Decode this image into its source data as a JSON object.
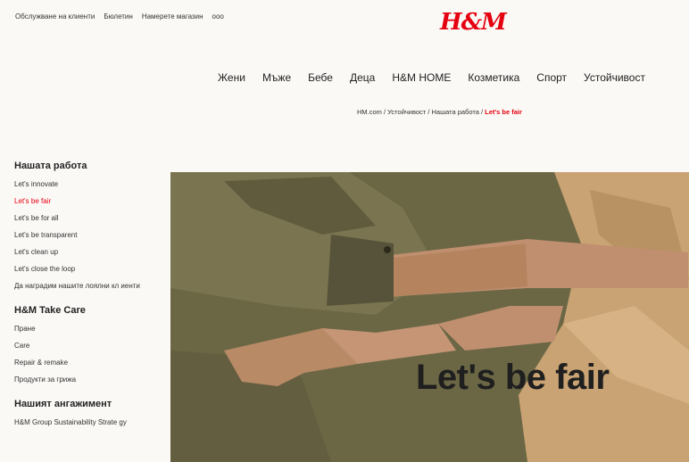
{
  "topbar": {
    "links": [
      "Обслужване на клиенти",
      "Бюлетин",
      "Намерете магазин",
      "ооо"
    ]
  },
  "logo": "H&M",
  "nav": {
    "items": [
      "Жени",
      "Мъже",
      "Бебе",
      "Деца",
      "H&M HOME",
      "Козметика",
      "Спорт",
      "Устойчивост"
    ]
  },
  "breadcrumb": {
    "path": "HM.com / Устойчивост / Нашата работа / ",
    "current": "Let's be fair"
  },
  "sidebar": {
    "sections": [
      {
        "title": "Нашата работа",
        "items": [
          "Let's innovate",
          "Let's be fair",
          "Let's be for all",
          "Let's be transparent",
          "Let's clean up",
          "Let's close the loop",
          "Да наградим нашите лоялни кл иенти"
        ]
      },
      {
        "title": "H&M Take Care",
        "items": [
          "Пране",
          "Care",
          "Repair & remake",
          "Продукти за грижа"
        ]
      },
      {
        "title": "Нашият ангажимент",
        "items": [
          "H&M Group Sustainability Strate gy"
        ]
      }
    ],
    "active_item": "Let's be fair"
  },
  "hero": {
    "title": "Let's be fair"
  },
  "colors": {
    "accent": "#e50010",
    "olive": "#6e6a47",
    "tan": "#c9a373",
    "skin": "#c08f70"
  }
}
